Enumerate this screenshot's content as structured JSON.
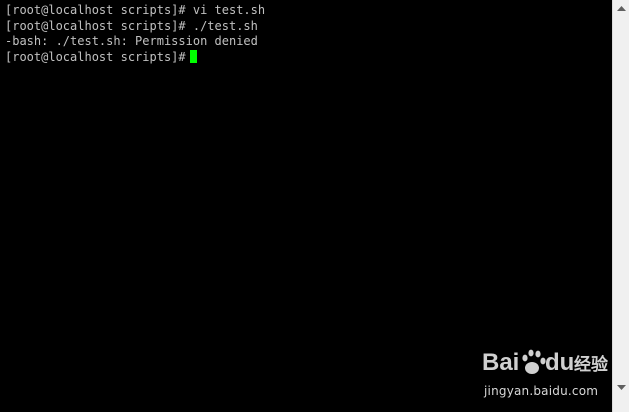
{
  "terminal": {
    "lines": [
      "[root@localhost scripts]# vi test.sh",
      "[root@localhost scripts]# ./test.sh",
      "-bash: ./test.sh: Permission denied",
      "[root@localhost scripts]#"
    ],
    "text_color": "#c0c0c0",
    "background_color": "#000000",
    "cursor_color": "#00ff00"
  },
  "scrollbar": {
    "up_icon": "scroll-up-arrow-icon",
    "down_icon": "scroll-down-arrow-icon"
  },
  "watermark": {
    "logo_text": "Baidu经验",
    "url": "jingyan.baidu.com"
  }
}
